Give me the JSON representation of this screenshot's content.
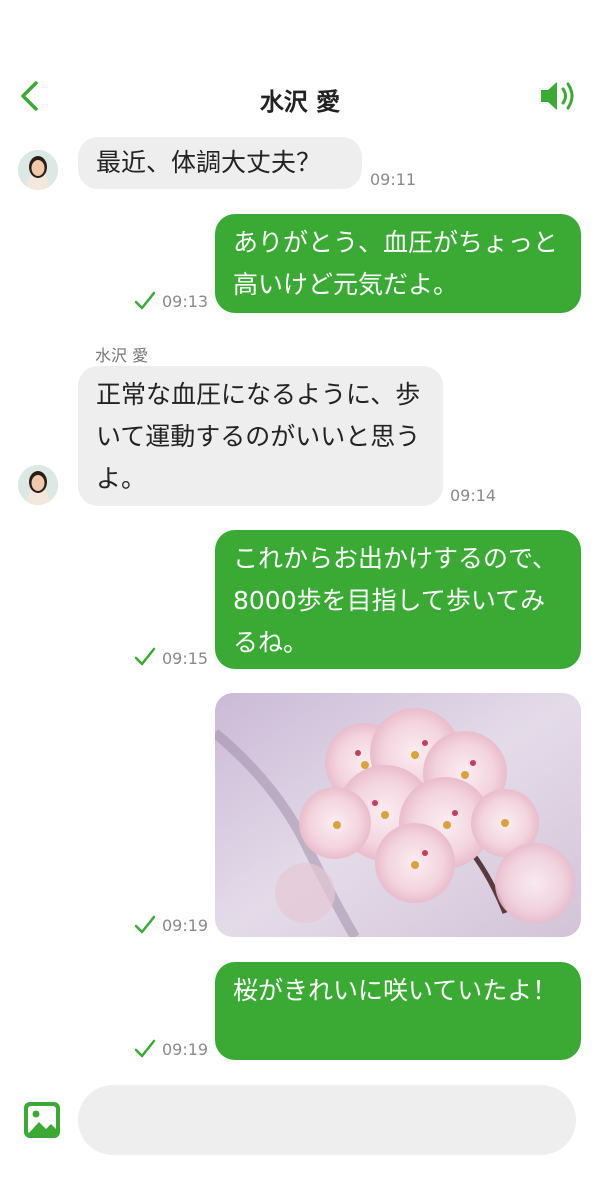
{
  "header": {
    "contact_name": "水沢 愛"
  },
  "colors": {
    "accent": "#3aaa35",
    "incoming_bubble": "#eeeeee"
  },
  "messages": [
    {
      "direction": "in",
      "text": "最近、体調大丈夫？",
      "time": "09:11"
    },
    {
      "direction": "out",
      "text": "ありがとう、血圧がちょっと高いけど元気だよ。",
      "time": "09:13",
      "read": true
    },
    {
      "direction": "in",
      "sender": "水沢 愛",
      "text": "正常な血圧になるように、歩いて運動するのがいいと思うよ。",
      "time": "09:14"
    },
    {
      "direction": "out",
      "text": "これからお出かけするので、8000歩を目指して歩いてみるね。",
      "time": "09:15",
      "read": true
    },
    {
      "direction": "out",
      "type": "image",
      "image": "cherry-blossom-photo",
      "time": "09:19",
      "read": true
    },
    {
      "direction": "out",
      "text": "桜がきれいに咲いていたよ！",
      "time": "09:19",
      "read": true
    }
  ],
  "composer": {
    "placeholder": "",
    "value": ""
  }
}
